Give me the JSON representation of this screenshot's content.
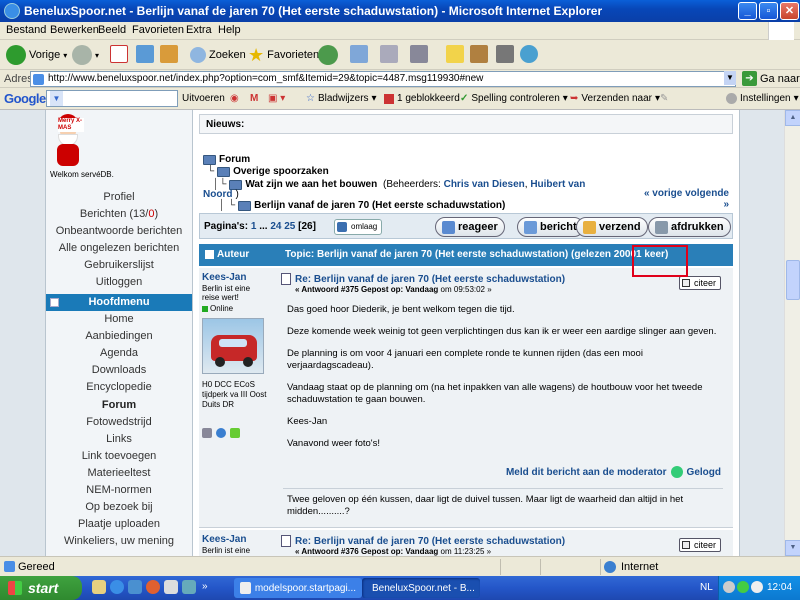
{
  "window": {
    "title": "BeneluxSpoor.net - Berlijn vanaf de jaren 70 (Het eerste schaduwstation) - Microsoft Internet Explorer"
  },
  "menubar": [
    "Bestand",
    "Bewerken",
    "Beeld",
    "Favorieten",
    "Extra",
    "Help"
  ],
  "toolbar": {
    "back": "Vorige",
    "search": "Zoeken",
    "favorites": "Favorieten"
  },
  "address": {
    "label": "Adres",
    "url": "http://www.beneluxspoor.net/index.php?option=com_smf&Itemid=29&topic=4487.msg119930#new",
    "go": "Ga naar"
  },
  "googlebar": {
    "logo": "Google",
    "search_value": "G-",
    "items": [
      "Uitvoeren",
      "Bladwijzers",
      "1 geblokkeerd",
      "Spelling controleren",
      "Verzenden naar",
      "Instellingen"
    ]
  },
  "sidebar": {
    "greeting_img": "Merry X-MAS",
    "welcome": "Welkom servéDB.",
    "top_links": [
      "Profiel",
      "Berichten (13/",
      "Onbeantwoorde berichten",
      "Alle ongelezen berichten",
      "Gebruikerslijst",
      "Uitloggen"
    ],
    "unread_count": "0",
    "unread_close": ")",
    "menu_head": "Hoofdmenu",
    "menu_links": [
      "Home",
      "Aanbiedingen",
      "Agenda",
      "Downloads",
      "Encyclopedie",
      "Forum",
      "Fotowedstrijd",
      "Links",
      "Link toevoegen",
      "Materieeltest",
      "NEM-normen",
      "Op bezoek bij",
      "Plaatje uploaden",
      "Winkeliers, uw mening"
    ]
  },
  "main": {
    "news": "Nieuws:",
    "breadcrumb": {
      "forum": "Forum",
      "board": "Overige spoorzaken",
      "sub": "Wat zijn we aan het bouwen",
      "mods_prefix": "(Beheerders:",
      "mod1": "Chris van Diesen",
      "mod_sep": ",",
      "mod2": "Huibert van",
      "mod2b": "Noord",
      "mods_suffix": ")",
      "topic": "Berlijn vanaf de jaren 70 (Het eerste schaduwstation)"
    },
    "prevnext": "« vorige volgende »",
    "pages": {
      "label": "Pagina's:",
      "p1": "1",
      "dots": "...",
      "p24": "24",
      "p25": "25",
      "current": "[26]",
      "omlaag": "omlaag"
    },
    "buttons": {
      "reply": "reageer",
      "notify": "bericht",
      "send": "verzend",
      "print": "afdrukken"
    },
    "topicbar": {
      "author_col": "Auteur",
      "topic": "Topic: Berlijn vanaf de jaren 70 (Het eerste schaduwstation)  (gelezen 20001 keer)"
    },
    "posts": [
      {
        "author": "Kees-Jan",
        "usertitle": "Berlin ist eine reise wert!",
        "status": "Online",
        "signature_side": "H0 DCC ECoS tijdperk va III Oost Duits DR",
        "subject": "Re: Berlijn vanaf de jaren 70 (Het eerste schaduwstation)",
        "meta_prefix": "« Antwoord #375 Gepost op: Vandaag",
        "meta_time": "om 09:53:02 »",
        "quote": "citeer",
        "body": [
          "Das goed hoor Diederik, je bent welkom tegen die tijd.",
          "Deze komende week weinig tot geen verplichtingen dus kan ik er weer een aardige slinger aan geven.",
          "De planning is om voor 4 januari een complete ronde te kunnen rijden (das een mooi verjaardagscadeau).",
          "Vandaag staat op de planning om (na het inpakken van alle wagens) de houtbouw voor het tweede schaduwstation te gaan bouwen.",
          "Kees-Jan",
          "Vanavond weer foto's!"
        ],
        "report": "Meld dit bericht aan de moderator",
        "logged": "Gelogd",
        "signature": "Twee geloven op één kussen, daar ligt de duivel tussen. Maar ligt de waarheid dan altijd in het midden..........?"
      },
      {
        "author": "Kees-Jan",
        "usertitle": "Berlin ist eine",
        "subject": "Re: Berlijn vanaf de jaren 70 (Het eerste schaduwstation)",
        "meta_prefix": "« Antwoord #376 Gepost op: Vandaag",
        "meta_time": "om 11:23:25 »",
        "quote": "citeer"
      }
    ]
  },
  "statusbar": {
    "text": "Gereed",
    "zone": "Internet"
  },
  "taskbar": {
    "start": "start",
    "items": [
      "modelspoor.startpagi...",
      "BeneluxSpoor.net - B..."
    ],
    "lang": "NL",
    "clock": "12:04"
  },
  "colors": {
    "accent": "#2a7fb8",
    "highlight_box": "#e0001a",
    "link": "#1a4e8f"
  }
}
